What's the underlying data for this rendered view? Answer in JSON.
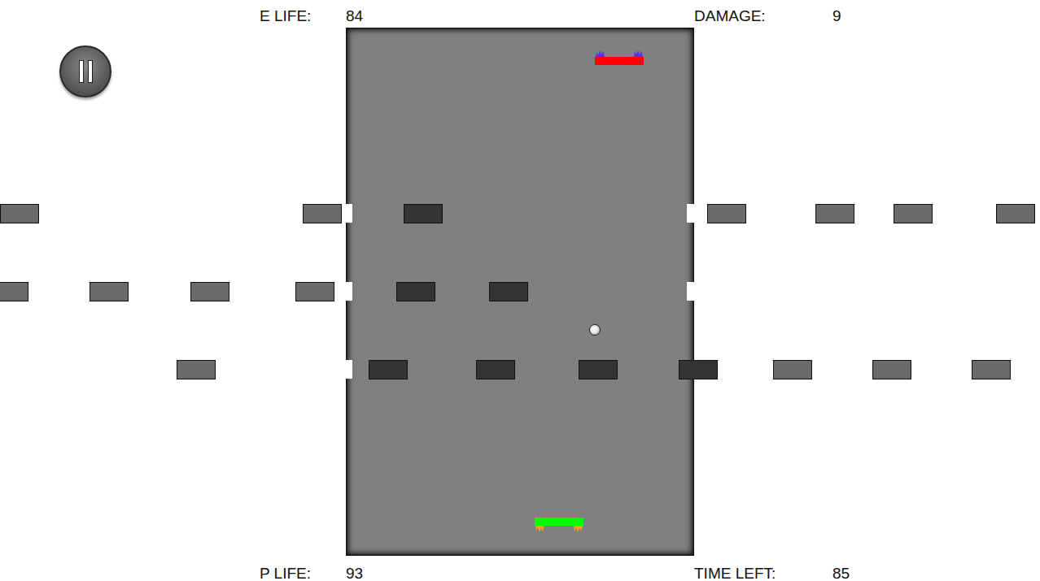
{
  "hud_top": [
    {
      "label": "E LIFE:",
      "value": "84"
    },
    {
      "label": "DAMAGE:",
      "value": "9"
    }
  ],
  "hud_bottom": [
    {
      "label": "P LIFE:",
      "value": "93"
    },
    {
      "label": "TIME LEFT:",
      "value": "85"
    }
  ],
  "pause_button": {
    "paused": false
  },
  "brick_rows": [
    {
      "bricks": [
        {
          "dark": false
        },
        {
          "dark": false
        },
        {
          "dark": true
        },
        {
          "dark": false
        },
        {
          "dark": false
        },
        {
          "dark": false
        },
        {
          "dark": false
        }
      ]
    },
    {
      "bricks": [
        {
          "dark": false
        },
        {
          "dark": false
        },
        {
          "dark": false
        },
        {
          "dark": false
        },
        {
          "dark": true
        },
        {
          "dark": true
        }
      ]
    },
    {
      "bricks": [
        {
          "dark": false
        },
        {
          "dark": true
        },
        {
          "dark": true
        },
        {
          "dark": true
        },
        {
          "dark": true
        },
        {
          "dark": false
        },
        {
          "dark": false
        },
        {
          "dark": false
        }
      ]
    }
  ]
}
